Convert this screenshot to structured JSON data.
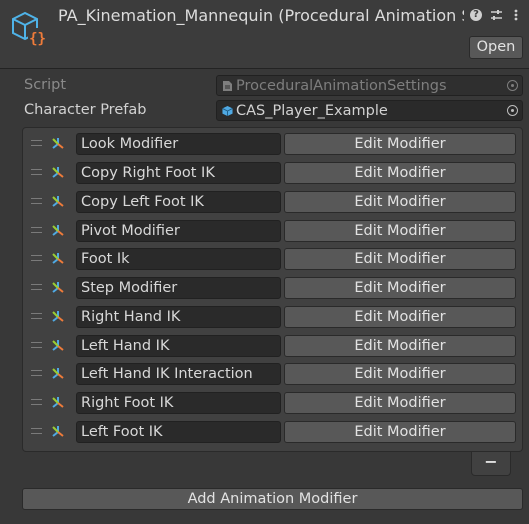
{
  "header": {
    "title": "PA_Kinemation_Mannequin (Procedural Animation Settings)",
    "icon": "script-asset-icon",
    "icon_glyph": "{}",
    "accent_color": "#4fb3e8",
    "brace_color": "#ee7b3a",
    "open_label": "Open",
    "header_icons": [
      "help-icon",
      "settings-sliders-icon",
      "more-vert-icon"
    ]
  },
  "properties": [
    {
      "label": "Script",
      "value": "ProceduralAnimationSettings",
      "icon": "script-file-icon"
    },
    {
      "label": "Character Prefab",
      "value": "CAS_Player_Example",
      "icon": "prefab-cube-icon"
    }
  ],
  "modifiers": [
    {
      "name": "Look Modifier",
      "button": "Edit Modifier"
    },
    {
      "name": "Copy Right Foot IK",
      "button": "Edit Modifier"
    },
    {
      "name": "Copy Left Foot IK",
      "button": "Edit Modifier"
    },
    {
      "name": "Pivot Modifier",
      "button": "Edit Modifier"
    },
    {
      "name": "Foot Ik",
      "button": "Edit Modifier"
    },
    {
      "name": "Step Modifier",
      "button": "Edit Modifier"
    },
    {
      "name": "Right Hand IK",
      "button": "Edit Modifier"
    },
    {
      "name": "Left Hand IK",
      "button": "Edit Modifier"
    },
    {
      "name": "Left Hand IK Interaction",
      "button": "Edit Modifier"
    },
    {
      "name": "Right Foot IK",
      "button": "Edit Modifier"
    },
    {
      "name": "Left Foot IK",
      "button": "Edit Modifier"
    }
  ],
  "list_footer": {
    "remove_label": "−"
  },
  "add_button": "Add Animation Modifier"
}
